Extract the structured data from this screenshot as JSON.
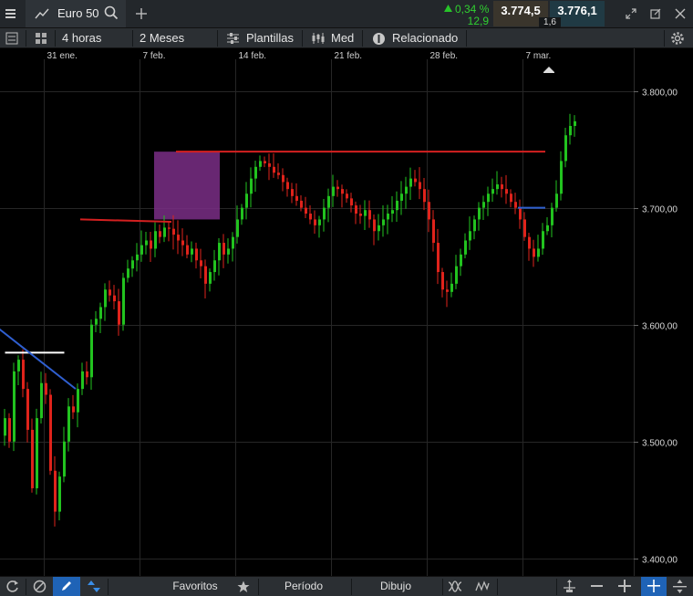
{
  "tab": {
    "title": "Euro 50"
  },
  "quote": {
    "change_pct": "0,34 %",
    "change_abs": "12,9",
    "sell": "3.774,5",
    "buy": "3.776,1",
    "spread": "1,6"
  },
  "toolbar": {
    "interval": "4 horas",
    "range": "2 Meses",
    "templates": "Plantillas",
    "studies": "Med",
    "related": "Relacionado"
  },
  "bottom": {
    "favorites": "Favoritos",
    "period": "Período",
    "drawing": "Dibujo"
  },
  "chart_data": {
    "type": "candlestick",
    "x_ticks": [
      "31 ene.",
      "7 feb.",
      "14 feb.",
      "21 feb.",
      "28 feb.",
      "7 mar."
    ],
    "y_ticks": [
      "3.400,00",
      "3.500,00",
      "3.600,00",
      "3.700,00",
      "3.800,00"
    ],
    "ylim": [
      3385,
      3827
    ],
    "up_color": "#22c31f",
    "down_color": "#e0231b",
    "closes": [
      3520,
      3500,
      3560,
      3570,
      3545,
      3510,
      3460,
      3520,
      3550,
      3540,
      3475,
      3440,
      3470,
      3500,
      3530,
      3525,
      3545,
      3560,
      3555,
      3600,
      3605,
      3615,
      3630,
      3625,
      3620,
      3600,
      3640,
      3648,
      3655,
      3660,
      3668,
      3672,
      3665,
      3680,
      3675,
      3683,
      3682,
      3677,
      3672,
      3668,
      3660,
      3665,
      3655,
      3650,
      3635,
      3645,
      3655,
      3670,
      3660,
      3665,
      3675,
      3690,
      3700,
      3712,
      3725,
      3735,
      3740,
      3738,
      3735,
      3730,
      3728,
      3722,
      3716,
      3710,
      3706,
      3700,
      3695,
      3690,
      3685,
      3690,
      3700,
      3710,
      3718,
      3716,
      3712,
      3708,
      3702,
      3695,
      3693,
      3698,
      3690,
      3680,
      3685,
      3690,
      3695,
      3698,
      3706,
      3712,
      3718,
      3725,
      3722,
      3716,
      3705,
      3690,
      3670,
      3645,
      3630,
      3628,
      3635,
      3650,
      3660,
      3672,
      3680,
      3690,
      3700,
      3705,
      3712,
      3716,
      3720,
      3716,
      3712,
      3705,
      3700,
      3690,
      3675,
      3665,
      3658,
      3665,
      3680,
      3685,
      3700,
      3712,
      3740,
      3762,
      3770,
      3774
    ],
    "lines": [
      {
        "from": [
          0.5,
          3576
        ],
        "to": [
          13.5,
          3576
        ],
        "color": "#ffffff"
      },
      {
        "from": [
          -2,
          3600
        ],
        "to": [
          16,
          3545
        ],
        "color": "#2f5fd0"
      },
      {
        "from": [
          17,
          3690
        ],
        "to": [
          37,
          3688
        ],
        "color": "#d42020"
      },
      {
        "from": [
          38,
          3748
        ],
        "to": [
          119,
          3748
        ],
        "color": "#d42020"
      },
      {
        "from": [
          113,
          3700
        ],
        "to": [
          119,
          3700
        ],
        "color": "#2f5fd0"
      }
    ],
    "zone": {
      "from": 30,
      "to": 43,
      "y": [
        3690,
        3748
      ],
      "color": "#7a2e86"
    }
  }
}
